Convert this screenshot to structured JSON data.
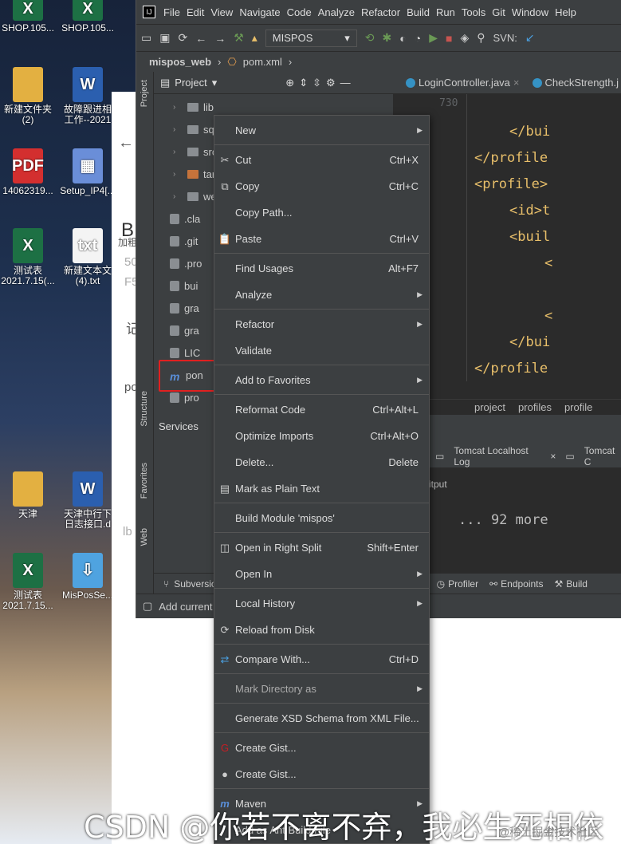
{
  "desktop": {
    "icons": [
      {
        "label": "SHOP.105...",
        "type": "xls"
      },
      {
        "label": "SHOP.105...",
        "type": "xls"
      },
      {
        "label": "新建文件夹\n(2)",
        "type": "fld"
      },
      {
        "label": "故障跟进相\n工作--2021",
        "type": "doc"
      },
      {
        "label": "14062319...",
        "type": "pdf"
      },
      {
        "label": "Setup_IP4[...",
        "type": "setup"
      },
      {
        "label": "测试表\n2021.7.15(...",
        "type": "xls"
      },
      {
        "label": "新建文本文\n(4).txt",
        "type": "txt"
      },
      {
        "label": "天津",
        "type": "fld"
      },
      {
        "label": "天津中行下\n日志接口.d",
        "type": "doc"
      },
      {
        "label": "测试表\n2021.7.15...",
        "type": "xls"
      },
      {
        "label": "MisPosSe...",
        "type": "zip"
      }
    ]
  },
  "ide": {
    "menu": [
      "File",
      "Edit",
      "View",
      "Navigate",
      "Code",
      "Analyze",
      "Refactor",
      "Build",
      "Run",
      "Tools",
      "Git",
      "Window",
      "Help"
    ],
    "run_config": "MISPOS",
    "svn_label": "SVN:",
    "breadcrumb": {
      "project": "mispos_web",
      "file": "pom.xml"
    },
    "project_panel": {
      "title": "Project",
      "items": [
        {
          "label": "lib",
          "kind": "folder"
        },
        {
          "label": "sql",
          "kind": "folder"
        },
        {
          "label": "src",
          "kind": "folder"
        },
        {
          "label": "targ",
          "kind": "folder-orange"
        },
        {
          "label": "web",
          "kind": "folder"
        },
        {
          "label": ".cla",
          "kind": "file"
        },
        {
          "label": ".git",
          "kind": "file"
        },
        {
          "label": ".pro",
          "kind": "file"
        },
        {
          "label": "bui",
          "kind": "file"
        },
        {
          "label": "gra",
          "kind": "file"
        },
        {
          "label": "gra",
          "kind": "file"
        },
        {
          "label": "LIC",
          "kind": "file"
        },
        {
          "label": "pon",
          "kind": "maven"
        },
        {
          "label": "pro",
          "kind": "file"
        }
      ]
    },
    "editor_tabs": [
      "LoginController.java",
      "CheckStrength.j"
    ],
    "code_lines": [
      {
        "indent": 0,
        "text": "730",
        "kind": "lineno"
      },
      {
        "indent": 3,
        "text": "</bui"
      },
      {
        "indent": 1,
        "text": "</profile"
      },
      {
        "indent": 1,
        "text": "<profile>"
      },
      {
        "indent": 3,
        "text": "<id>t"
      },
      {
        "indent": 3,
        "text": "<buil"
      },
      {
        "indent": 5,
        "text": "<"
      },
      {
        "indent": 5,
        "text": ""
      },
      {
        "indent": 5,
        "text": "<"
      },
      {
        "indent": 3,
        "text": "</bui"
      },
      {
        "indent": 1,
        "text": "</profile"
      }
    ],
    "structure_crumbs": [
      "project",
      "profiles",
      "profile"
    ],
    "services_title": "Services",
    "console_tabs": [
      "Tomcat Localhost Log",
      "Tomcat C"
    ],
    "console_output_label": "itput",
    "console_more": "... 92 more",
    "bottom_tools": [
      "Subversio",
      "Profiler",
      "Endpoints",
      "Build"
    ],
    "status_text": "Add current",
    "side_labels": [
      "Project",
      "Structure",
      "Favorites",
      "Web"
    ]
  },
  "context_menu": {
    "items": [
      {
        "label": "New",
        "shortcut": "",
        "submenu": true,
        "icon": ""
      },
      {
        "sep": true
      },
      {
        "label": "Cut",
        "shortcut": "Ctrl+X",
        "icon": "cut-icon",
        "glyph": "✂"
      },
      {
        "label": "Copy",
        "shortcut": "Ctrl+C",
        "icon": "copy-icon",
        "glyph": "⧉"
      },
      {
        "label": "Copy Path...",
        "shortcut": "",
        "icon": ""
      },
      {
        "label": "Paste",
        "shortcut": "Ctrl+V",
        "icon": "paste-icon",
        "glyph": "📋"
      },
      {
        "sep": true
      },
      {
        "label": "Find Usages",
        "shortcut": "Alt+F7",
        "icon": ""
      },
      {
        "label": "Analyze",
        "shortcut": "",
        "submenu": true,
        "icon": ""
      },
      {
        "sep": true
      },
      {
        "label": "Refactor",
        "shortcut": "",
        "submenu": true,
        "icon": ""
      },
      {
        "label": "Validate",
        "shortcut": "",
        "icon": ""
      },
      {
        "sep": true
      },
      {
        "label": "Add to Favorites",
        "shortcut": "",
        "submenu": true,
        "icon": ""
      },
      {
        "sep": true
      },
      {
        "label": "Reformat Code",
        "shortcut": "Ctrl+Alt+L",
        "icon": ""
      },
      {
        "label": "Optimize Imports",
        "shortcut": "Ctrl+Alt+O",
        "icon": ""
      },
      {
        "label": "Delete...",
        "shortcut": "Delete",
        "icon": ""
      },
      {
        "label": "Mark as Plain Text",
        "shortcut": "",
        "icon": "plain-text-icon",
        "glyph": "▤"
      },
      {
        "sep": true
      },
      {
        "label": "Build Module 'mispos'",
        "shortcut": "",
        "icon": ""
      },
      {
        "sep": true
      },
      {
        "label": "Open in Right Split",
        "shortcut": "Shift+Enter",
        "icon": "split-icon",
        "glyph": "◫"
      },
      {
        "label": "Open In",
        "shortcut": "",
        "submenu": true,
        "icon": ""
      },
      {
        "sep": true
      },
      {
        "label": "Local History",
        "shortcut": "",
        "submenu": true,
        "icon": ""
      },
      {
        "label": "Reload from Disk",
        "shortcut": "",
        "icon": "reload-icon",
        "glyph": "⟳"
      },
      {
        "sep": true
      },
      {
        "label": "Compare With...",
        "shortcut": "Ctrl+D",
        "icon": "compare-icon",
        "glyph": "⇄"
      },
      {
        "sep": true
      },
      {
        "label": "Mark Directory as",
        "shortcut": "",
        "submenu": true,
        "icon": "",
        "dim": true
      },
      {
        "sep": true
      },
      {
        "label": "Generate XSD Schema from XML File...",
        "shortcut": "",
        "icon": ""
      },
      {
        "sep": true
      },
      {
        "label": "Create Gist...",
        "shortcut": "",
        "icon": "gitee-icon",
        "glyph": "G"
      },
      {
        "label": "Create Gist...",
        "shortcut": "",
        "icon": "github-icon",
        "glyph": "●"
      },
      {
        "sep": true
      },
      {
        "label": "Maven",
        "shortcut": "",
        "submenu": true,
        "icon": "maven-icon",
        "glyph": "m"
      },
      {
        "label": "Add as Ant Build File",
        "shortcut": "",
        "icon": ""
      }
    ]
  },
  "page_text": [
    "记",
    "po",
    "B",
    "加粗",
    "50",
    "F5",
    "lb"
  ],
  "watermark": "CSDN @你若不离不弃，我必生死相依",
  "watermark_small": "@稀土掘金技术社区"
}
